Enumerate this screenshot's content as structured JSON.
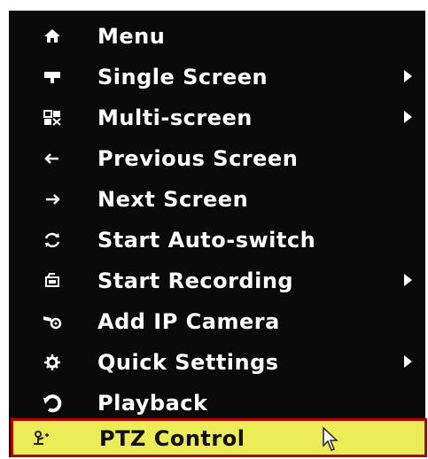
{
  "menu": {
    "items": [
      {
        "label": "Menu",
        "icon": "home-icon",
        "has_submenu": false
      },
      {
        "label": "Single Screen",
        "icon": "monitor-icon",
        "has_submenu": true
      },
      {
        "label": "Multi-screen",
        "icon": "multi-screen-icon",
        "has_submenu": true
      },
      {
        "label": "Previous Screen",
        "icon": "arrow-left-icon",
        "has_submenu": false
      },
      {
        "label": "Next Screen",
        "icon": "arrow-right-icon",
        "has_submenu": false
      },
      {
        "label": "Start Auto-switch",
        "icon": "refresh-icon",
        "has_submenu": false
      },
      {
        "label": "Start Recording",
        "icon": "record-icon",
        "has_submenu": true
      },
      {
        "label": "Add IP Camera",
        "icon": "camera-icon",
        "has_submenu": false
      },
      {
        "label": "Quick Settings",
        "icon": "gear-icon",
        "has_submenu": true
      },
      {
        "label": "Playback",
        "icon": "playback-icon",
        "has_submenu": false
      },
      {
        "label": "PTZ Control",
        "icon": "ptz-icon",
        "has_submenu": false,
        "highlighted": true
      }
    ]
  },
  "colors": {
    "menu_background": "#0a0a0a",
    "highlight_background": "#ecec58",
    "highlight_border": "#b30000",
    "text": "#ffffff"
  }
}
